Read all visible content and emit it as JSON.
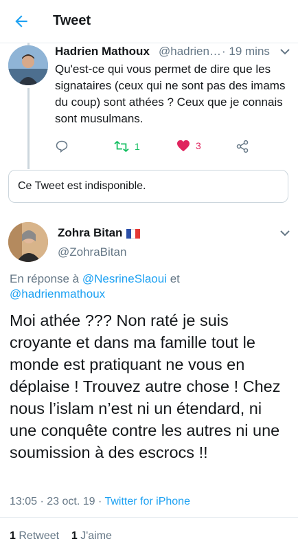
{
  "header": {
    "title": "Tweet"
  },
  "reply_tweet": {
    "name": "Hadrien Mathoux",
    "handle": "@hadrienmathoux",
    "time": "· 19 mins",
    "text": "Qu'est-ce qui vous permet de dire que les signataires (ceux qui ne sont pas des imams du coup) sont athées ? Ceux que je connais sont musulmans.",
    "retweets": "1",
    "likes": "3",
    "colors": {
      "retweet": "#17bf63",
      "like": "#e0245e",
      "icon": "#657786"
    }
  },
  "unavailable": {
    "text": "Ce Tweet est indisponible."
  },
  "main_tweet": {
    "name": "Zohra Bitan",
    "flag": "🇫🇷",
    "handle": "@ZohraBitan",
    "in_reply_prefix": "En réponse à",
    "in_reply_user1": "@NesrineSlaoui",
    "in_reply_and": "et",
    "in_reply_user2": "@hadrienmathoux",
    "text": "Moi athée ??? Non raté je suis croyante et dans ma famille tout le monde est pratiquant ne vous en déplaise ! Trouvez autre chose ! Chez nous l’islam n’est ni un étendard, ni une conquête contre les autres ni une soumission à des escrocs !!",
    "timestamp": "13:05 · 23 oct. 19 ·",
    "source": "Twitter for iPhone",
    "retweet_count": "1",
    "retweet_label": "Retweet",
    "like_count": "1",
    "like_label": "J'aime"
  },
  "accent_color": "#1da1f2"
}
